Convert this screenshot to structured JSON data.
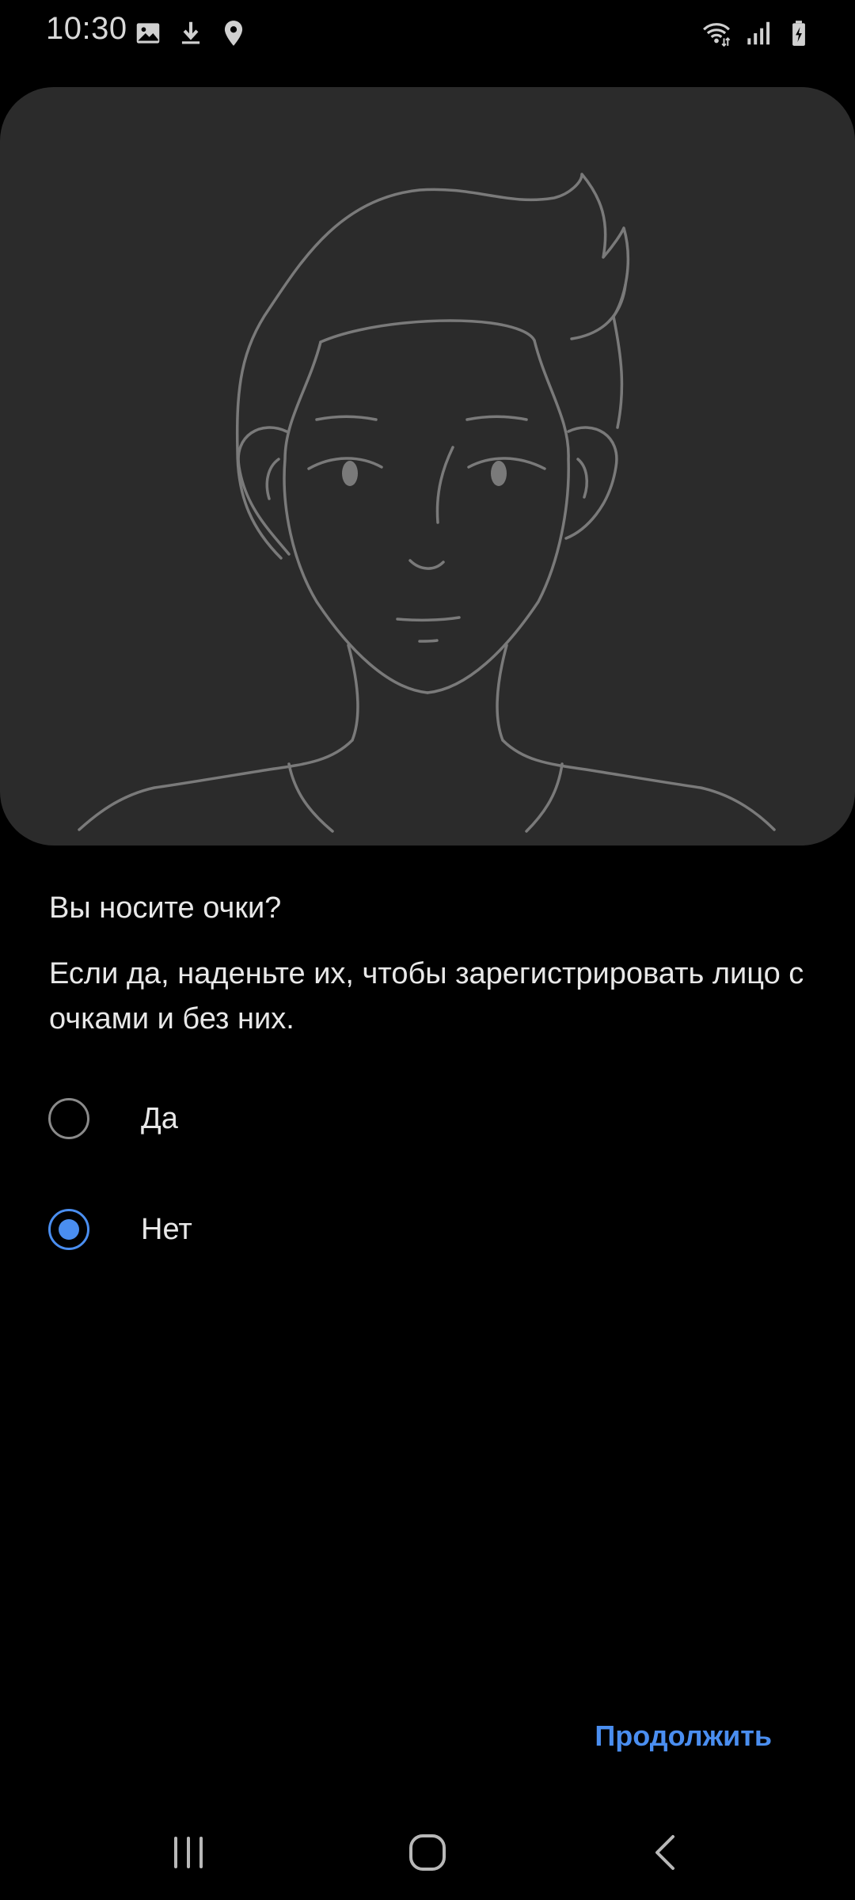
{
  "status_bar": {
    "time": "10:30",
    "left_icons": [
      "image-icon",
      "download-icon",
      "location-pin-icon"
    ],
    "right_icons": [
      "wifi-icon",
      "cell-signal-icon",
      "battery-charging-icon"
    ]
  },
  "illustration": {
    "icon": "face-outline-illustration"
  },
  "content": {
    "question": "Вы носите очки?",
    "description": "Если да, наденьте их, чтобы зарегистрировать лицо с очками и без них."
  },
  "options": [
    {
      "label": "Да",
      "checked": false
    },
    {
      "label": "Нет",
      "checked": true
    }
  ],
  "actions": {
    "continue_label": "Продолжить"
  },
  "nav_bar": {
    "icons": [
      "recents-icon",
      "home-icon",
      "back-icon"
    ]
  },
  "colors": {
    "background": "#000000",
    "card": "#2b2b2b",
    "accent": "#4a8ef0",
    "text": "#e8e8e8",
    "line_art": "#8a8a8a"
  }
}
